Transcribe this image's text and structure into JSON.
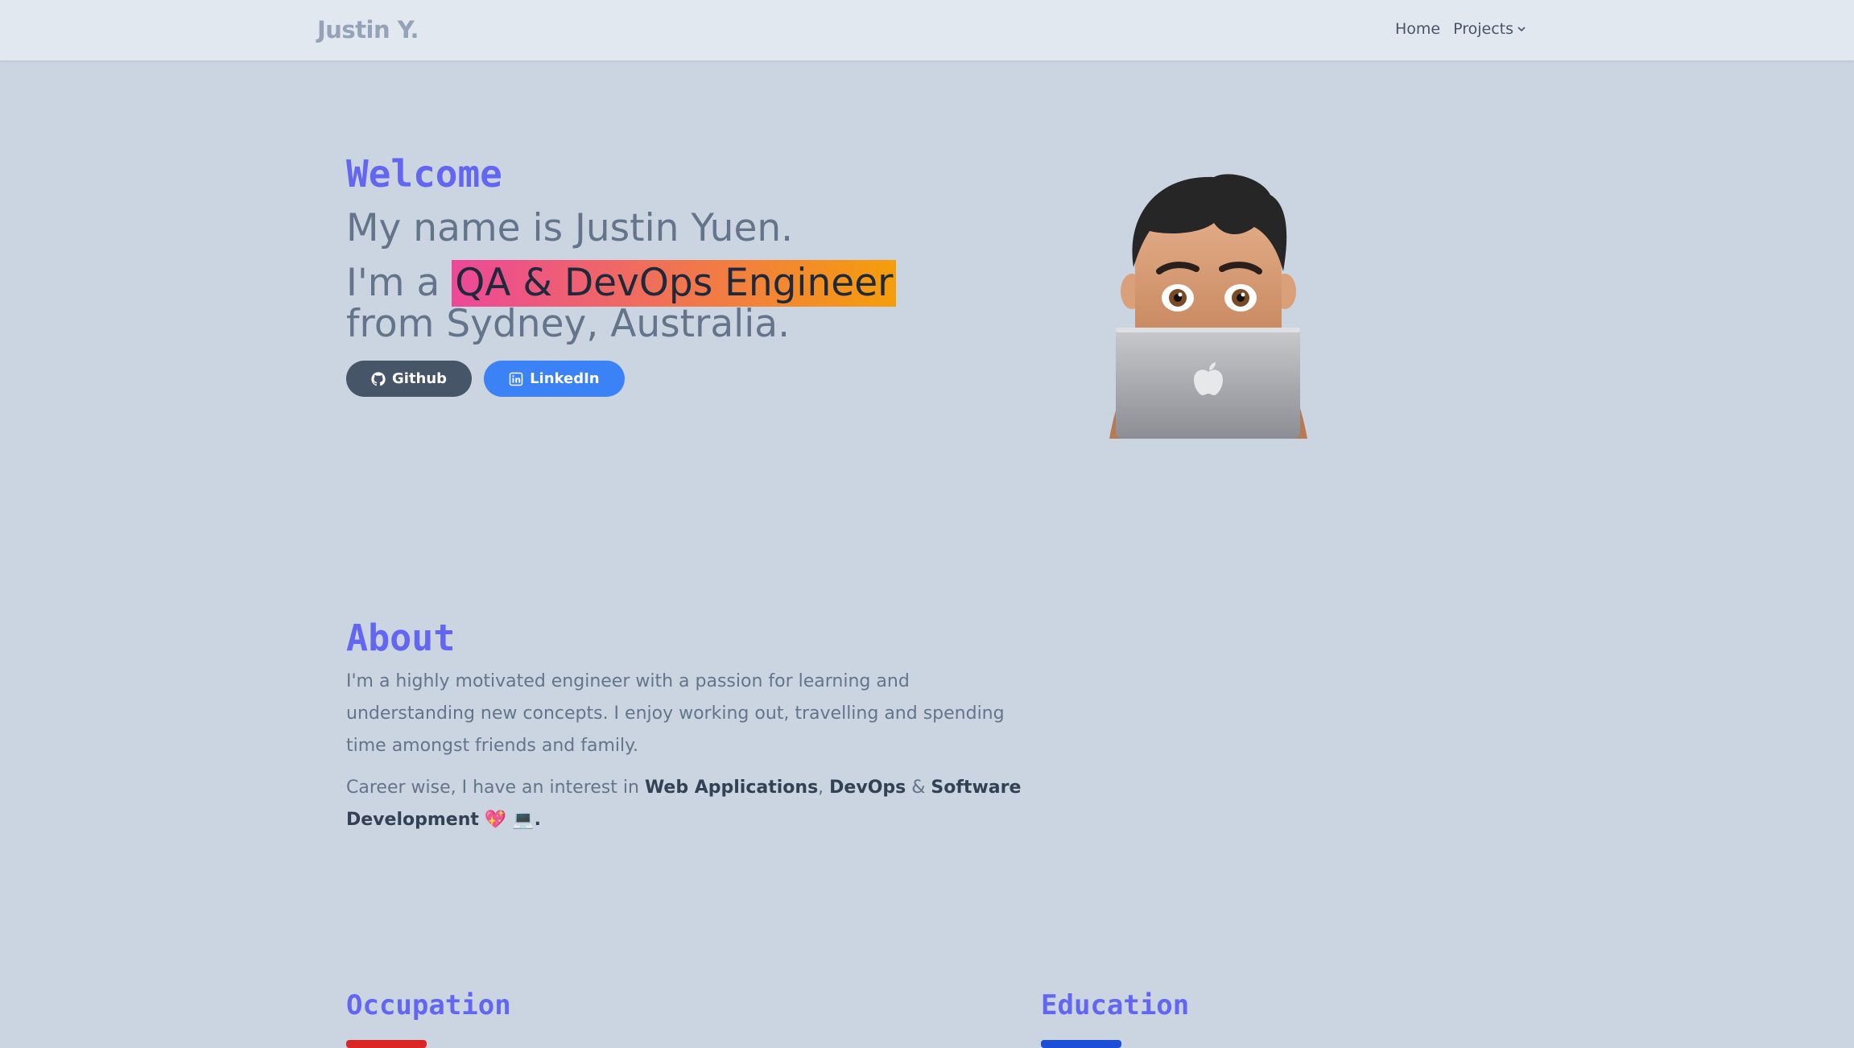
{
  "nav": {
    "brand": "Justin Y.",
    "home": "Home",
    "projects": "Projects"
  },
  "hero": {
    "welcome": "Welcome",
    "name_line": "My name is Justin Yuen.",
    "role_prefix": "I'm a",
    "role": "QA & DevOps Engineer",
    "location_line": "from Sydney, Australia.",
    "github_label": "Github",
    "linkedin_label": "LinkedIn"
  },
  "about": {
    "title": "About",
    "paragraph1": "I'm a highly motivated engineer with a passion for learning and understanding new concepts. I enjoy working out, travelling and spending time amongst friends and family.",
    "p2_prefix": "Career wise, I have an interest in",
    "interest1": "Web Applications",
    "comma": ",",
    "interest2": "DevOps",
    "amp": "&",
    "interest3": "Software Development",
    "emojis": "💖 💻",
    "period": "."
  },
  "sections": {
    "occupation": "Occupation",
    "education": "Education"
  },
  "icons": {
    "github": "github-icon",
    "linkedin": "linkedin-icon",
    "chevron": "chevron-down-icon"
  },
  "colors": {
    "accent": "#6366f1",
    "background": "#cbd5e1",
    "navbar": "#e2e8f0",
    "github_button": "#475569",
    "linkedin_button": "#3b82f6",
    "highlight_start": "#ec4899",
    "highlight_end": "#f59e0b"
  }
}
